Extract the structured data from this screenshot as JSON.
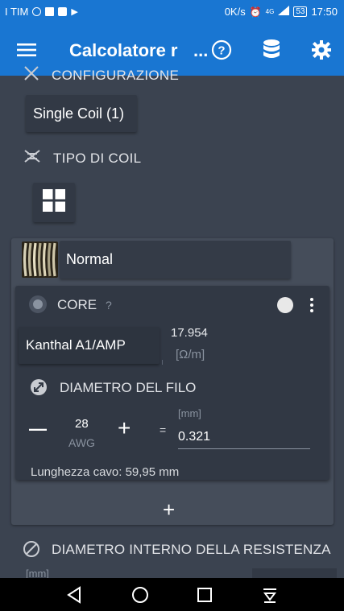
{
  "statusbar": {
    "carrier": "I TIM",
    "speed": "0K/s",
    "network": "4G",
    "battery": "53",
    "time": "17:50"
  },
  "toolbar": {
    "title": "Calcolatore r",
    "ellipsis": "...",
    "icons": [
      "menu-icon",
      "help-icon",
      "database-icon",
      "settings-icon"
    ]
  },
  "sections": {
    "configurazione": {
      "label": "CONFIGURAZIONE",
      "value": "Single Coil (1)"
    },
    "tipo_coil": {
      "label": "TIPO DI COIL"
    },
    "coil": {
      "name": "Normal",
      "core": {
        "label": "CORE",
        "help": "?",
        "material": "Kanthal A1/AMP",
        "resistivity_value": "17.954",
        "resistivity_unit": "[Ω/m]",
        "diameter_label": "DIAMETRO DEL FILO",
        "gauge": "28",
        "gauge_unit": "AWG",
        "minus": "—",
        "plus": "+",
        "equals": "=",
        "mm_unit": "[mm]",
        "mm_value": "0.321",
        "length_text": "Lunghezza cavo: 59,95 mm"
      },
      "add": "+"
    },
    "diametro_interno": {
      "label": "DIAMETRO INTERNO DELLA RESISTENZA",
      "unit": "[mm]"
    }
  },
  "colors": {
    "accent": "#1976d2",
    "background": "#3b4350",
    "card": "#313844"
  }
}
